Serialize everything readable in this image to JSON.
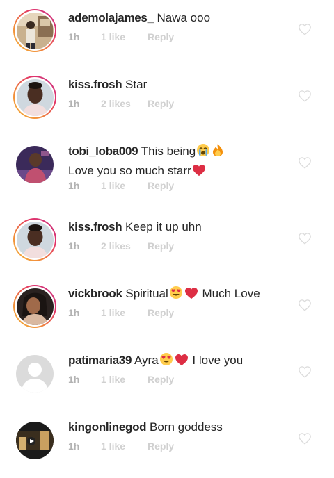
{
  "comments": [
    {
      "username": "ademolajames_",
      "text": "Nawa ooo",
      "time": "1h",
      "likes": "1 like",
      "reply": "Reply",
      "avatar": "photo-man-outdoor-icon",
      "story": true
    },
    {
      "username": "kiss.frosh",
      "text": "Star",
      "time": "1h",
      "likes": "2 likes",
      "reply": "Reply",
      "avatar": "photo-girl-portrait-icon",
      "story": true
    },
    {
      "username": "tobi_loba009",
      "text": "This being",
      "emojis": [
        "crying-face-emoji",
        "fire-emoji"
      ],
      "text2": "Love you so much starr",
      "emojis2": [
        "red-heart-emoji"
      ],
      "time": "1h",
      "likes": "1 like",
      "reply": "Reply",
      "avatar": "photo-man-dark-icon",
      "story": false
    },
    {
      "username": "kiss.frosh",
      "text": "Keep it up uhn",
      "time": "1h",
      "likes": "2 likes",
      "reply": "Reply",
      "avatar": "photo-girl-portrait-icon",
      "story": true
    },
    {
      "username": "vickbrook",
      "text": "Spiritual",
      "emojis": [
        "heart-eyes-emoji",
        "red-heart-emoji"
      ],
      "text_after": "Much Love",
      "time": "1h",
      "likes": "1 like",
      "reply": "Reply",
      "avatar": "photo-woman-icon",
      "story": true
    },
    {
      "username": "patimaria39",
      "text": "Ayra",
      "emojis": [
        "heart-eyes-emoji",
        "red-heart-emoji"
      ],
      "text_after": "I love you",
      "time": "1h",
      "likes": "1 like",
      "reply": "Reply",
      "avatar": "default-avatar-icon",
      "story": false
    },
    {
      "username": "kingonlinegod",
      "text": "Born goddess",
      "time": "1h",
      "likes": "1 like",
      "reply": "Reply",
      "avatar": "photo-video-thumbnail-icon",
      "story": false
    }
  ],
  "colors": {
    "username": "#262626",
    "meta": "#c7c7c7",
    "heart_outline": "#dbdbdb",
    "story_ring_start": "#f6b73c",
    "story_ring_end": "#c13584"
  }
}
